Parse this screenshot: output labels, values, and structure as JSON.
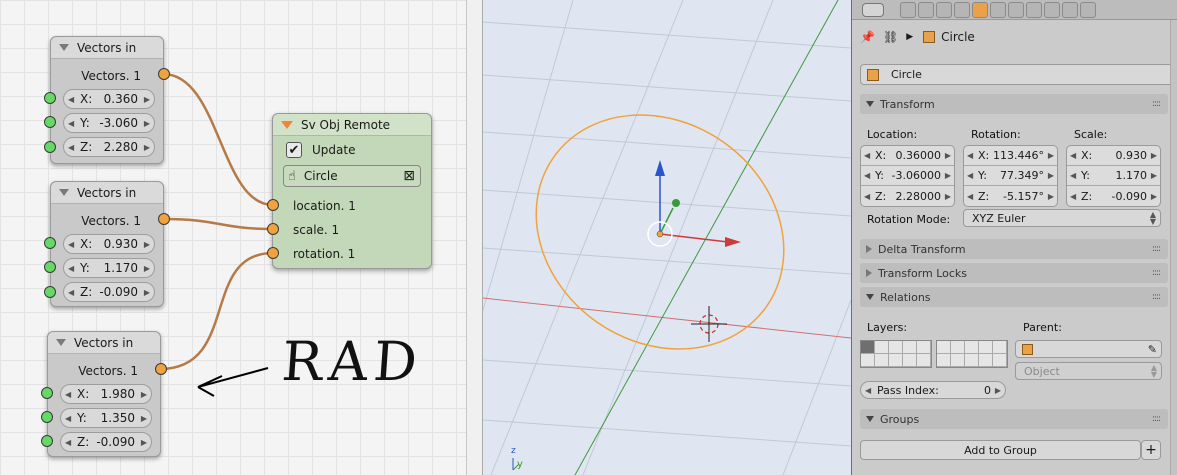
{
  "node_editor": {
    "vector_nodes": [
      {
        "title": "Vectors in",
        "output": "Vectors. 1",
        "rows": [
          {
            "axis": "X:",
            "value": "0.360"
          },
          {
            "axis": "Y:",
            "value": "-3.060"
          },
          {
            "axis": "Z:",
            "value": "2.280"
          }
        ]
      },
      {
        "title": "Vectors in",
        "output": "Vectors. 1",
        "rows": [
          {
            "axis": "X:",
            "value": "0.930"
          },
          {
            "axis": "Y:",
            "value": "1.170"
          },
          {
            "axis": "Z:",
            "value": "-0.090"
          }
        ]
      },
      {
        "title": "Vectors in",
        "output": "Vectors. 1",
        "rows": [
          {
            "axis": "X:",
            "value": "1.980"
          },
          {
            "axis": "Y:",
            "value": "1.350"
          },
          {
            "axis": "Z:",
            "value": "-0.090"
          }
        ]
      }
    ],
    "remote_node": {
      "title": "Sv Obj Remote",
      "update_label": "Update",
      "object_name": "Circle",
      "inputs": [
        "location. 1",
        "scale. 1",
        "rotation. 1"
      ]
    },
    "annotation": "RAD"
  },
  "viewport": {
    "axis_z": "z",
    "axis_y": "y"
  },
  "properties": {
    "breadcrumb_object": "Circle",
    "object_name_field": "Circle",
    "transform_panel": {
      "title": "Transform",
      "location_label": "Location:",
      "rotation_label": "Rotation:",
      "scale_label": "Scale:",
      "location": [
        {
          "axis": "X:",
          "value": "0.36000"
        },
        {
          "axis": "Y:",
          "value": "-3.06000"
        },
        {
          "axis": "Z:",
          "value": "2.28000"
        }
      ],
      "rotation": [
        {
          "axis": "X:",
          "value": "113.446°"
        },
        {
          "axis": "Y:",
          "value": "77.349°"
        },
        {
          "axis": "Z:",
          "value": "-5.157°"
        }
      ],
      "scale": [
        {
          "axis": "X:",
          "value": "0.930"
        },
        {
          "axis": "Y:",
          "value": "1.170"
        },
        {
          "axis": "Z:",
          "value": "-0.090"
        }
      ],
      "rotation_mode_label": "Rotation Mode:",
      "rotation_mode_value": "XYZ Euler"
    },
    "delta_transform_title": "Delta Transform",
    "transform_locks_title": "Transform Locks",
    "relations_panel": {
      "title": "Relations",
      "layers_label": "Layers:",
      "parent_label": "Parent:",
      "parent_type_placeholder": "Object",
      "pass_index_label": "Pass Index:",
      "pass_index_value": "0"
    },
    "groups_panel": {
      "title": "Groups",
      "add_to_group_label": "Add to Group"
    }
  },
  "colors": {
    "wire": "#c58a55",
    "remote_node_bg": "#c3d8b8",
    "object_outline": "#f0a23c",
    "x_axis": "#cc3a3a",
    "y_axis": "#3a9a3a",
    "z_axis": "#2a55cc"
  }
}
